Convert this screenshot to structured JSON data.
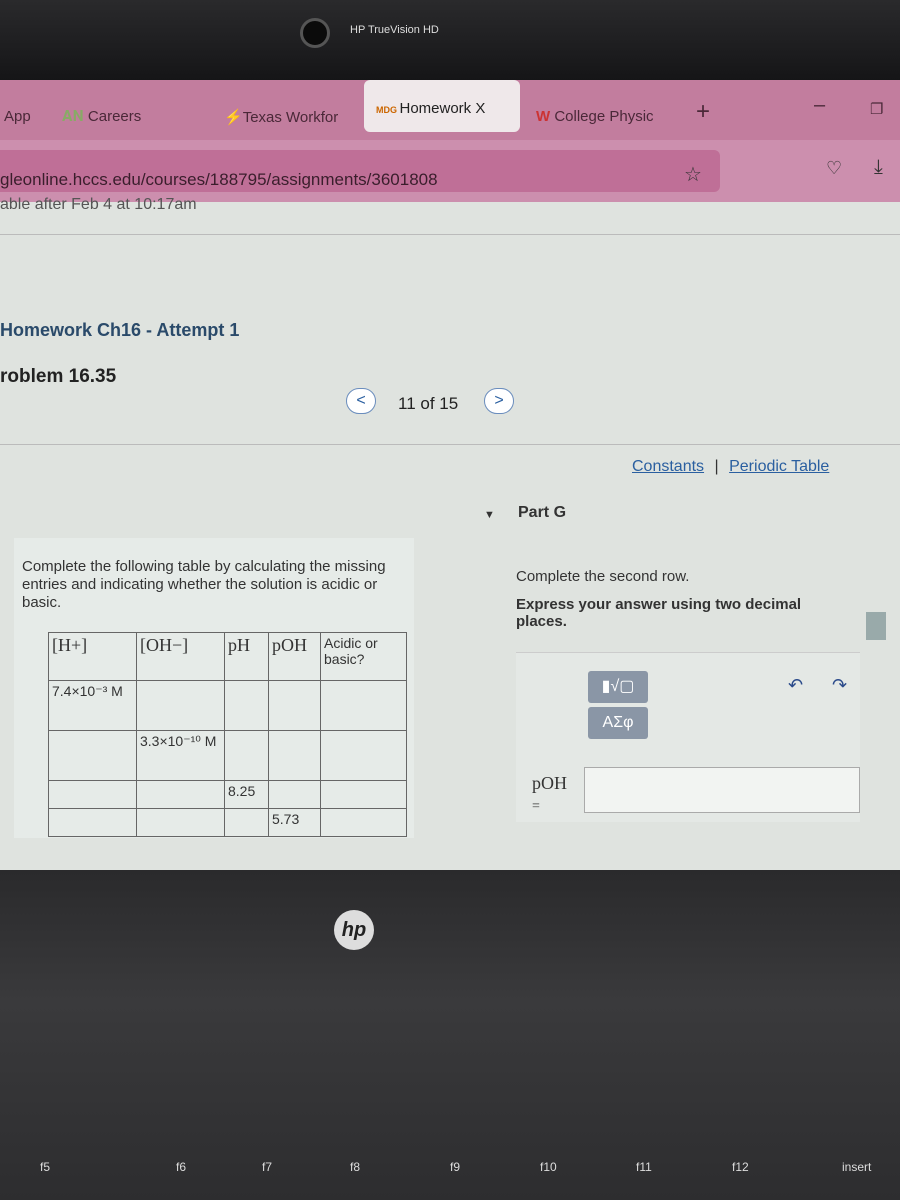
{
  "camera_label": "HP TrueVision HD",
  "tabs": [
    {
      "label": "App"
    },
    {
      "label": "Careers"
    },
    {
      "label": "Texas Workfor"
    },
    {
      "label": "Homework X",
      "active": true
    },
    {
      "label": "College Physic"
    }
  ],
  "new_tab": "+",
  "url": "gleonline.hccs.edu/courses/188795/assignments/3601808",
  "available": "able  after Feb 4 at 10:17am",
  "assignment_title": "Homework Ch16 - Attempt 1",
  "problem": "roblem 16.35",
  "pager": {
    "prev": "<",
    "next": ">",
    "position": "11 of 15"
  },
  "links": {
    "constants": "Constants",
    "sep": "|",
    "periodic": "Periodic Table"
  },
  "question": "Complete the following table by calculating the missing entries and indicating whether the solution is acidic or basic.",
  "table": {
    "headers": [
      "[H+]",
      "[OH−]",
      "pH",
      "pOH",
      "Acidic or basic?"
    ],
    "rows": [
      [
        "7.4×10⁻³ M",
        "",
        "",
        "",
        ""
      ],
      [
        "",
        "3.3×10⁻¹⁰ M",
        "",
        "",
        ""
      ],
      [
        "",
        "",
        "8.25",
        "",
        ""
      ],
      [
        "",
        "",
        "",
        "5.73",
        ""
      ]
    ]
  },
  "part": "Part G",
  "instruction": "Complete the second row.",
  "instruction2": "Express your answer using two decimal places.",
  "toolbar": {
    "template": "▮√▢",
    "greek": "ΑΣφ"
  },
  "answer": {
    "label": "pOH",
    "eq": "=",
    "value": ""
  },
  "laptop_logo": "hp",
  "keys": [
    "f5",
    "f6",
    "f7",
    "f8",
    "f9",
    "f10",
    "f11",
    "f12",
    "insert"
  ]
}
